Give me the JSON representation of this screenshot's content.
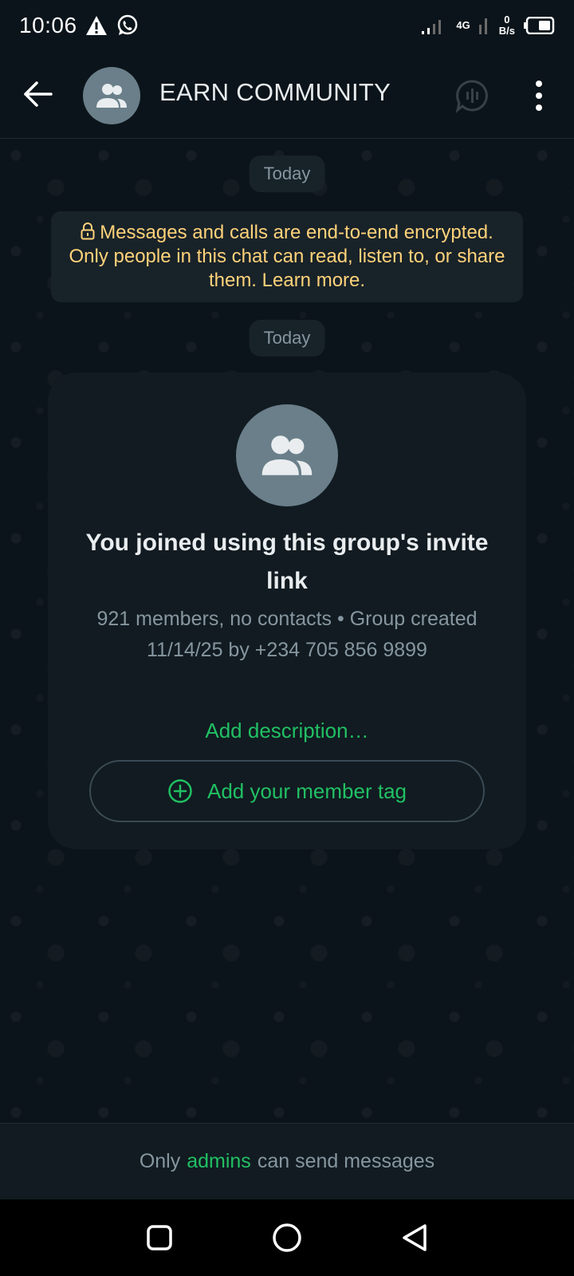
{
  "status_bar": {
    "time": "10:06",
    "network_type": "4G",
    "net_speed_value": "0",
    "net_speed_unit": "B/s"
  },
  "header": {
    "title": "EARN COMMUNITY",
    "icons": [
      "back-arrow-icon",
      "group-avatar-icon",
      "voice-chat-icon",
      "more-options-icon"
    ]
  },
  "chat": {
    "date_chip_1": "Today",
    "encryption_note": "Messages and calls are end-to-end encrypted. Only people in this chat can read, listen to, or share them. Learn more.",
    "date_chip_2": "Today",
    "group_card": {
      "title": "You joined using this group's invite link",
      "subtitle": "921 members, no contacts • Group created 11/14/25 by +234 705 856 9899",
      "add_description": "Add description…",
      "member_tag_button": "Add your member tag"
    }
  },
  "footer": {
    "prefix": "Only",
    "link": "admins",
    "suffix": "can send messages"
  },
  "colors": {
    "background": "#0b141a",
    "card": "#111b21",
    "accent_green": "#21c063",
    "encryption_yellow": "#ffd279",
    "muted_text": "#8696a0"
  }
}
